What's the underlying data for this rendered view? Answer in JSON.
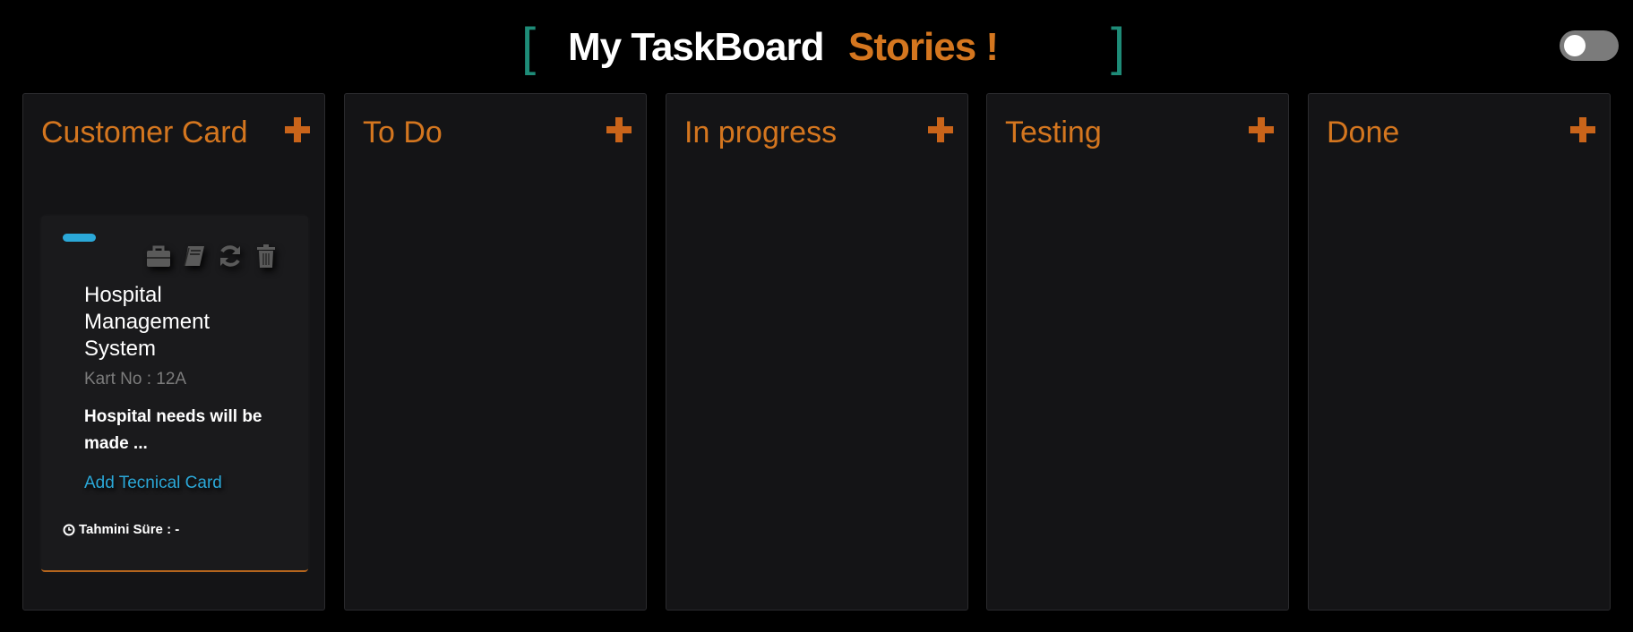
{
  "header": {
    "bracket_left": "[",
    "title": "My TaskBoard",
    "subtitle": "Stories !",
    "bracket_right": "]"
  },
  "theme": {
    "accent": "#d4761f",
    "bracket_color": "#1e8c78",
    "link_color": "#2ba8d8",
    "background": "#000000",
    "column_background": "#141416"
  },
  "toggle": {
    "state": "off"
  },
  "columns": [
    {
      "title": "Customer Card",
      "add_icon": "plus-icon"
    },
    {
      "title": "To Do",
      "add_icon": "plus-icon"
    },
    {
      "title": "In progress",
      "add_icon": "plus-icon"
    },
    {
      "title": "Testing",
      "add_icon": "plus-icon"
    },
    {
      "title": "Done",
      "add_icon": "plus-icon"
    }
  ],
  "card": {
    "tag_color": "#2ba8d8",
    "actions": [
      "briefcase-icon",
      "book-icon",
      "refresh-icon",
      "trash-icon"
    ],
    "title": "Hospital Management System",
    "number": "Kart No : 12A",
    "description": "Hospital needs will be made ...",
    "link": "Add Tecnical Card",
    "estimate": "Tahmini Süre : -"
  }
}
